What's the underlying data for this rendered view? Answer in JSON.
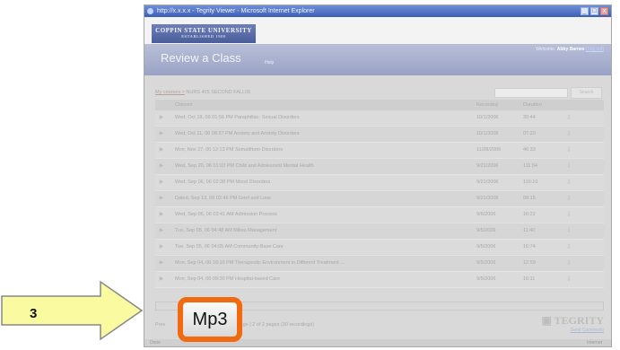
{
  "window": {
    "title": "http://x.x.x.x - Tegrity Viewer - Microsoft Internet Explorer",
    "controls": [
      "_",
      "□",
      "x"
    ]
  },
  "university": {
    "name": "COPPIN STATE UNIVERSITY",
    "established": "ESTABLISHED 1900"
  },
  "header": {
    "title": "Review a Class",
    "help": "Help",
    "welcome_prefix": "Welcome,",
    "user": "Abby Barnes",
    "logout": "(Log out)"
  },
  "breadcrumb": {
    "link": "My courses >",
    "course": "NURS 405 SECOND FALL06"
  },
  "search": {
    "button": "Search"
  },
  "table": {
    "headers": {
      "classes": "Classes",
      "recorded": "Recorded",
      "duration": "Duration"
    },
    "rows": [
      {
        "title": "Wed, Oct 18, 06 01:56 PM Paraphiliac- Sexual Disorders",
        "recorded": "10/1/2006",
        "duration": "30:44"
      },
      {
        "title": "Wed, Oct 11, 06 08:37 PM Anxiety and Anxiety Disorders",
        "recorded": "10/1/2006",
        "duration": "07:20"
      },
      {
        "title": "Mon, Nov 27, 06 12:13 PM Somatiform Disorders",
        "recorded": "11/28/2006",
        "duration": "46:33"
      },
      {
        "title": "Wed, Sep 20, 06 01:03 PM Child and Adolescent Mental Health",
        "recorded": "9/21/2006",
        "duration": "111:04"
      },
      {
        "title": "Wed, Sep 06, 06 02:38 PM Mood Disorders",
        "recorded": "9/21/2006",
        "duration": "116:10"
      },
      {
        "title": "Dated, Sep 13, 06 02:46 PM Grief and Loss",
        "recorded": "9/21/2006",
        "duration": "09:15"
      },
      {
        "title": "Wed, Sep 06, 06 03:41 AM Admission Process",
        "recorded": "9/6/2006",
        "duration": "16:22"
      },
      {
        "title": "Tue, Sep 05, 06 04:48 AM Milieu Management",
        "recorded": "9/5/2006",
        "duration": "11:40"
      },
      {
        "title": "Tue, Sep 05, 06 04:05 AM Community-Base Care",
        "recorded": "9/5/2006",
        "duration": "16:74"
      },
      {
        "title": "Mon, Sep 04, 06 10:10 PM Therapeutic Environment in Different Treatment ...",
        "recorded": "9/5/2006",
        "duration": "12:59"
      },
      {
        "title": "Mon, Sep 04, 06 09:30 PM Hospital-based Care",
        "recorded": "9/5/2006",
        "duration": "16:11"
      }
    ]
  },
  "pager": {
    "left": "Prev",
    "text": "Page | 2 of 2 pages (30 recordings)"
  },
  "brand": {
    "name": "TEGRITY",
    "send_comments": "Send Comments"
  },
  "statusbar": {
    "left": "Done",
    "right": "Internet"
  },
  "callout": {
    "button": "Mp3",
    "step": "3"
  },
  "colors": {
    "highlight": "#f26a10",
    "arrow": "#fafaa0"
  }
}
